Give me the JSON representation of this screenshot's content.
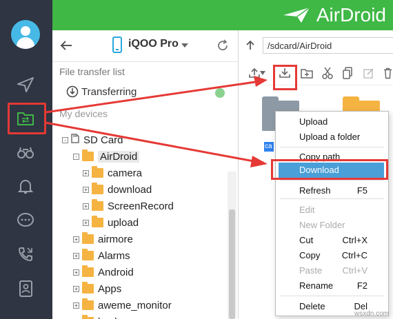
{
  "app": {
    "brand": "AirDroid"
  },
  "device": {
    "name": "iQOO Pro"
  },
  "transfer": {
    "caption": "File transfer list",
    "item": "Transferring",
    "devices_caption": "My devices"
  },
  "tree": [
    {
      "label": "SD Card",
      "indent": 0,
      "folder": false,
      "sign": "-"
    },
    {
      "label": "AirDroid",
      "indent": 1,
      "folder": true,
      "sign": "-",
      "selected": true
    },
    {
      "label": "camera",
      "indent": 2,
      "folder": true,
      "sign": "+"
    },
    {
      "label": "download",
      "indent": 2,
      "folder": true,
      "sign": "+"
    },
    {
      "label": "ScreenRecord",
      "indent": 2,
      "folder": true,
      "sign": "+"
    },
    {
      "label": "upload",
      "indent": 2,
      "folder": true,
      "sign": "+"
    },
    {
      "label": "airmore",
      "indent": 1,
      "folder": true,
      "sign": "+"
    },
    {
      "label": "Alarms",
      "indent": 1,
      "folder": true,
      "sign": "+"
    },
    {
      "label": "Android",
      "indent": 1,
      "folder": true,
      "sign": "+"
    },
    {
      "label": "Apps",
      "indent": 1,
      "folder": true,
      "sign": "+"
    },
    {
      "label": "aweme_monitor",
      "indent": 1,
      "folder": true,
      "sign": "+"
    },
    {
      "label": "backups",
      "indent": 1,
      "folder": true,
      "sign": "+"
    }
  ],
  "files": {
    "path": "/sdcard/AirDroid",
    "badge": "ca"
  },
  "menu": [
    {
      "label": "Upload",
      "key": "",
      "disabled": false
    },
    {
      "label": "Upload a folder",
      "key": "",
      "disabled": false
    },
    {
      "label": "Copy path",
      "key": "",
      "disabled": false
    },
    {
      "label": "Download",
      "key": "",
      "disabled": false,
      "active": true
    },
    {
      "label": "Refresh",
      "key": "F5",
      "disabled": false
    },
    {
      "label": "Edit",
      "key": "",
      "disabled": true
    },
    {
      "label": "New Folder",
      "key": "",
      "disabled": true
    },
    {
      "label": "Cut",
      "key": "Ctrl+X",
      "disabled": false
    },
    {
      "label": "Copy",
      "key": "Ctrl+C",
      "disabled": false
    },
    {
      "label": "Paste",
      "key": "Ctrl+V",
      "disabled": true
    },
    {
      "label": "Rename",
      "key": "F2",
      "disabled": false
    },
    {
      "label": "Delete",
      "key": "Del",
      "disabled": false
    }
  ],
  "watermark": "wsxdn.com",
  "colors": {
    "accent": "#3fb846",
    "sidebar": "#2f3542",
    "highlight": "#e53935",
    "menu_active": "#4a9fd8"
  },
  "icons": [
    "user-icon",
    "send-icon",
    "folder-transfer-icon",
    "binoculars-icon",
    "bell-icon",
    "chat-icon",
    "phone-icon",
    "contacts-icon",
    "back-icon",
    "phone-device-icon",
    "refresh-icon",
    "upload-arrow-icon",
    "download-icon",
    "new-folder-icon",
    "cut-icon",
    "copy-icon",
    "edit-icon",
    "delete-icon"
  ]
}
